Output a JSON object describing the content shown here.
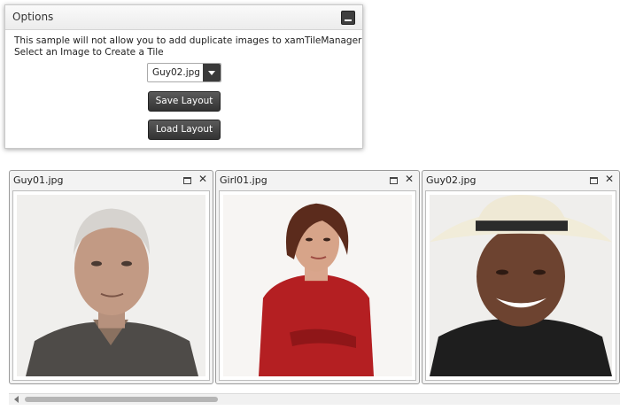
{
  "options": {
    "title": "Options",
    "description_line1": "This sample will not allow you to add duplicate images to xamTileManager",
    "description_line2": "Select an Image to Create a Tile",
    "selected_image": "Guy02.jpg",
    "save_label": "Save Layout",
    "load_label": "Load Layout"
  },
  "tiles": [
    {
      "title": "Guy01.jpg"
    },
    {
      "title": "Girl01.jpg"
    },
    {
      "title": "Guy02.jpg"
    }
  ],
  "icons": {
    "minimize": "minimize-icon",
    "maximize": "maximize-icon",
    "close": "close-icon",
    "dropdown": "chevron-down-icon",
    "scroll_left": "arrow-left-icon"
  },
  "colors": {
    "button_bg": "#3a3a3a",
    "tile_bg": "#f3f3f3",
    "panel_border": "#c9c9c9"
  }
}
